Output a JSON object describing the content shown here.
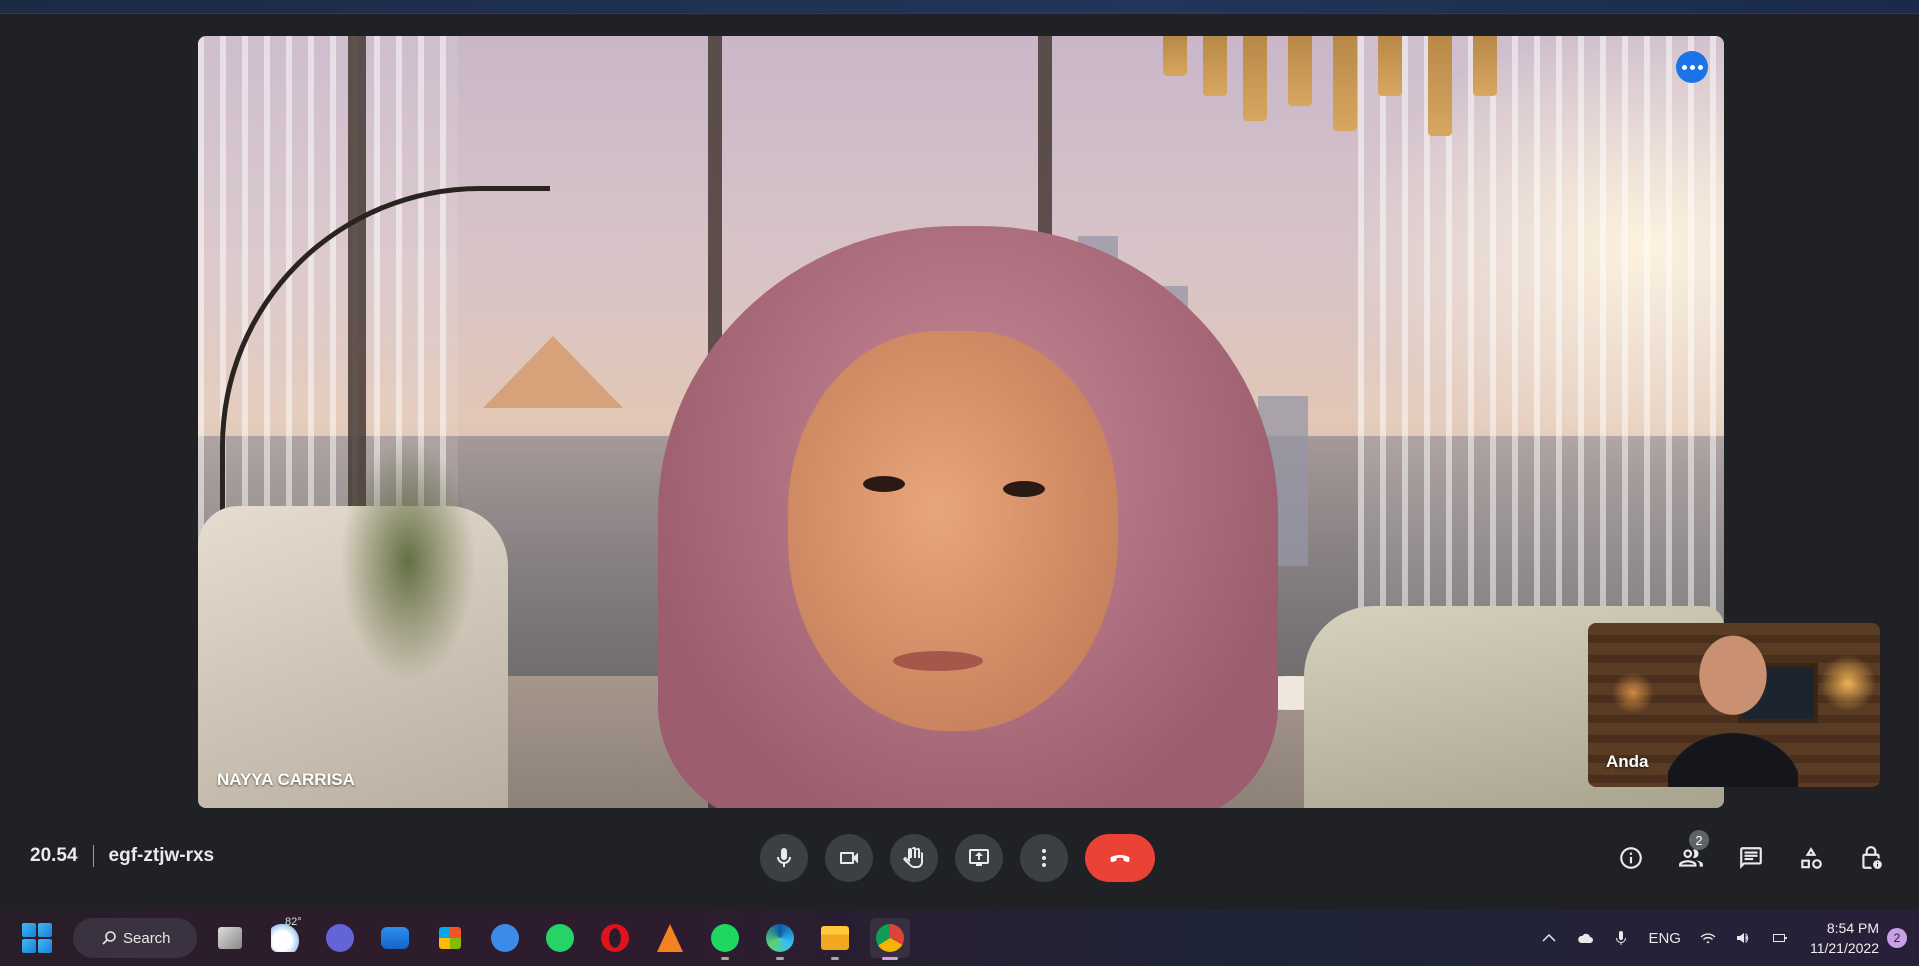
{
  "meeting": {
    "time": "20.54",
    "code": "egf-ztjw-rxs"
  },
  "main_tile": {
    "participant_name": "NAYYA CARRISA",
    "more_options_icon": "more-horizontal-icon",
    "accent_color": "#1a73e8"
  },
  "self_tile": {
    "participant_name": "Anda"
  },
  "controls": {
    "microphone_icon": "microphone-icon",
    "camera_icon": "camera-icon",
    "raise_hand_icon": "raise-hand-icon",
    "present_icon": "present-screen-icon",
    "more_icon": "more-vertical-icon",
    "end_call_icon": "end-call-icon",
    "end_call_color": "#ea4335"
  },
  "side_controls": {
    "info_icon": "info-icon",
    "people_icon": "people-icon",
    "people_count": "2",
    "chat_icon": "chat-icon",
    "activities_icon": "activities-icon",
    "host_controls_icon": "host-controls-icon"
  },
  "taskbar": {
    "search_label": "Search",
    "weather_temp": "82°",
    "apps": [
      "task-view",
      "weather",
      "teams-chat",
      "mail",
      "microsoft-store",
      "telegram-like",
      "whatsapp",
      "opera",
      "vlc",
      "spotify",
      "edge",
      "file-explorer",
      "chrome"
    ],
    "tray": {
      "language": "ENG",
      "time": "8:54 PM",
      "date": "11/21/2022",
      "notification_count": "2"
    }
  }
}
